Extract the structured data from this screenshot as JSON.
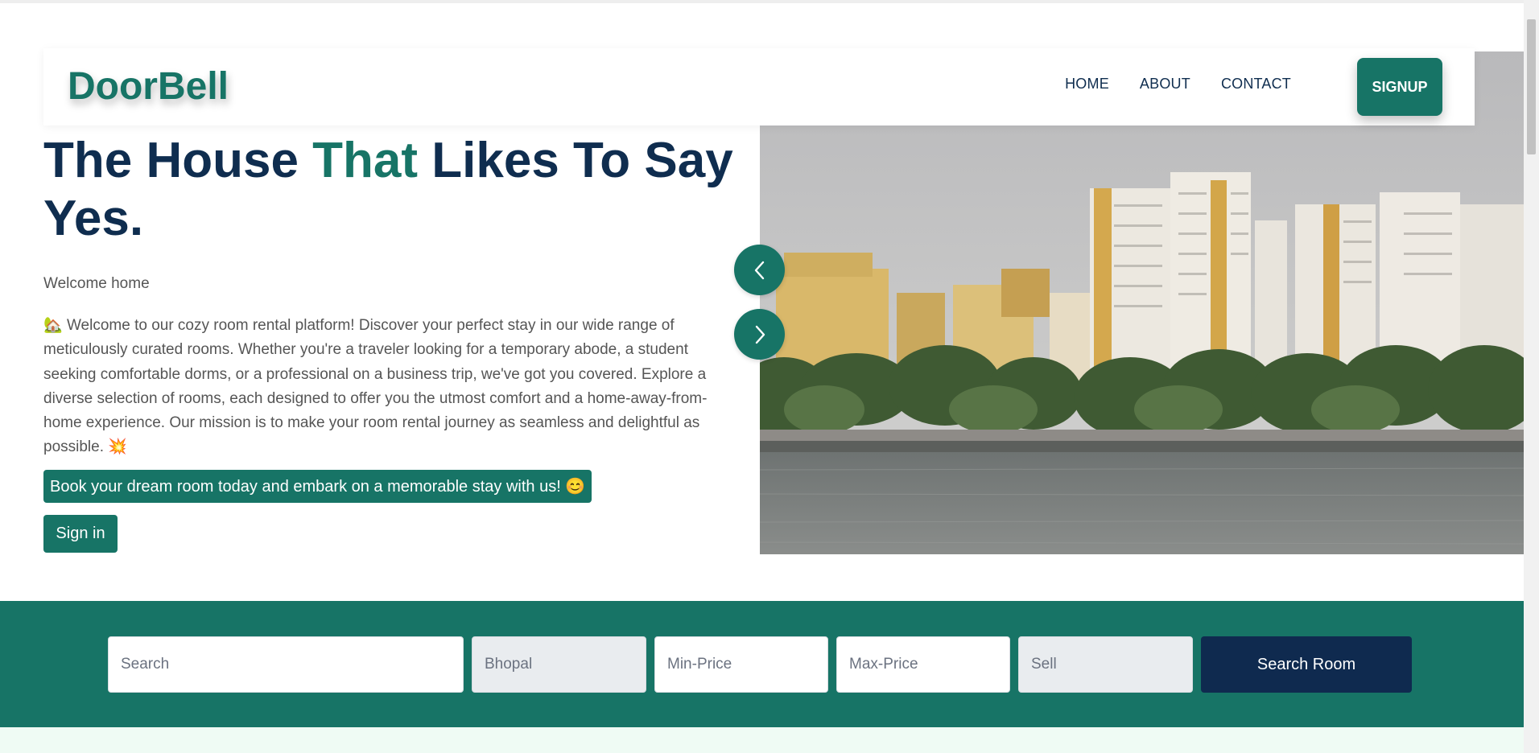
{
  "brand": {
    "name": "DoorBell",
    "accent_color": "#177466",
    "dark_color": "#0f2d4f"
  },
  "nav": {
    "links": [
      "HOME",
      "ABOUT",
      "CONTACT"
    ],
    "signup_label": "SIGNUP"
  },
  "hero": {
    "title_part1": "The House ",
    "title_accent": "That",
    "title_part2": " Likes To Say Yes.",
    "subtitle": "Welcome home",
    "description_icon": "🏡",
    "description": "Welcome to our cozy room rental platform! Discover your perfect stay in our wide range of meticulously curated rooms. Whether you're a traveler looking for a temporary abode, a student seeking comfortable dorms, or a professional on a business trip, we've got you covered. Explore a diverse selection of rooms, each designed to offer you the utmost comfort and a home-away-from-home experience. Our mission is to make your room rental journey as seamless and delightful as possible.",
    "description_end_icon": "💥",
    "promo": "Book your dream room today and embark on a memorable stay with us! 😊",
    "signin_label": "Sign in"
  },
  "carousel": {
    "prev_icon": "chevron-left-icon",
    "next_icon": "chevron-right-icon"
  },
  "search": {
    "search_placeholder": "Search",
    "city_value": "Bhopal",
    "min_price_placeholder": "Min-Price",
    "max_price_placeholder": "Max-Price",
    "type_value": "Sell",
    "button_label": "Search Room"
  }
}
